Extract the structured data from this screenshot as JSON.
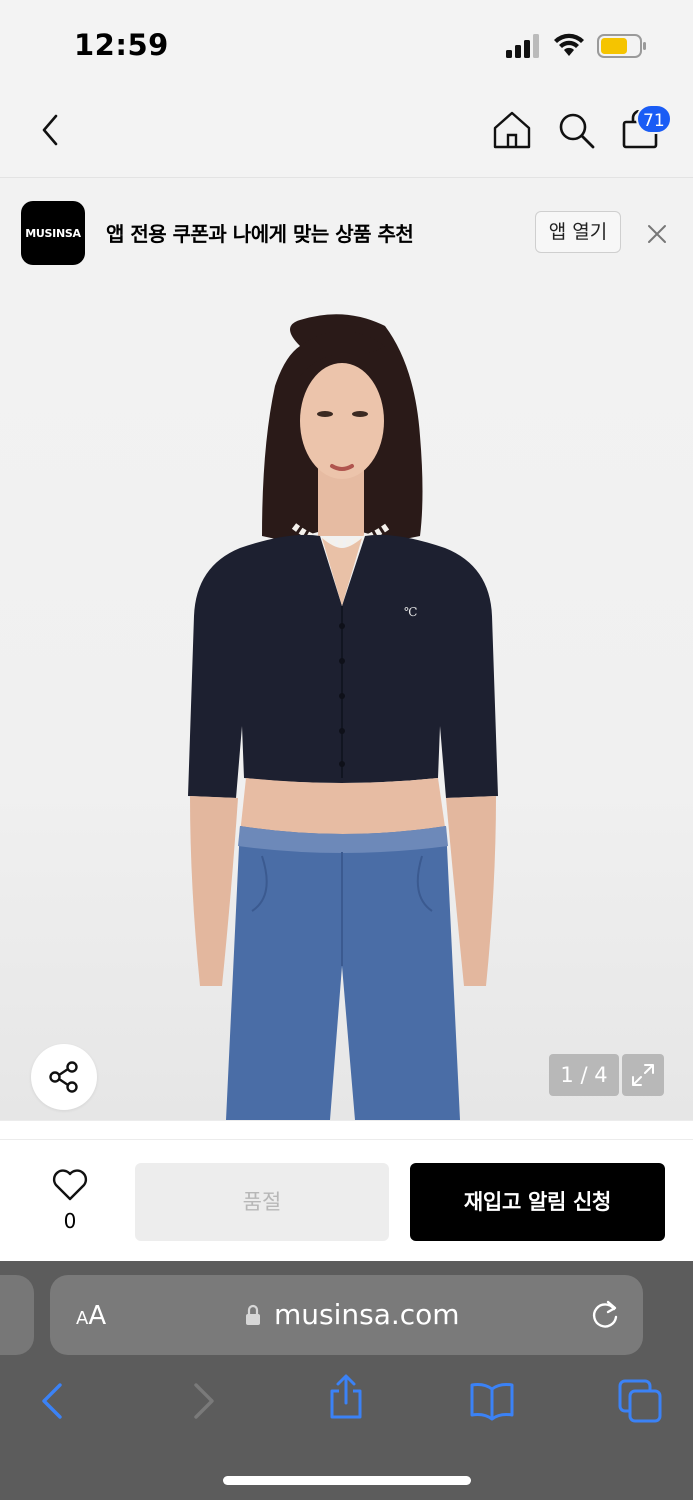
{
  "status_bar": {
    "time": "12:59"
  },
  "nav": {
    "cart_count": "71"
  },
  "app_banner": {
    "logo_text": "MUSINSA",
    "message": "앱 전용 쿠폰과 나에게 맞는 상품 추천",
    "open_app_label": "앱 열기"
  },
  "product": {
    "image_index": "1 / 4"
  },
  "actions": {
    "like_count": "0",
    "sold_out_label": "품절",
    "restock_label": "재입고 알림 신청"
  },
  "browser": {
    "aa_small": "A",
    "aa_large": "A",
    "url": "musinsa.com"
  },
  "colors": {
    "badge": "#1a5cf5",
    "primary_button": "#000000",
    "sold_out_bg": "#ededed",
    "safari_accent": "#3b82f6"
  },
  "icons": [
    "back-icon",
    "home-icon",
    "search-icon",
    "bag-icon",
    "close-icon",
    "share-icon",
    "expand-icon",
    "heart-icon",
    "lock-icon",
    "reload-icon",
    "chevron-left-icon",
    "chevron-right-icon",
    "share-up-icon",
    "book-icon",
    "tabs-icon"
  ]
}
